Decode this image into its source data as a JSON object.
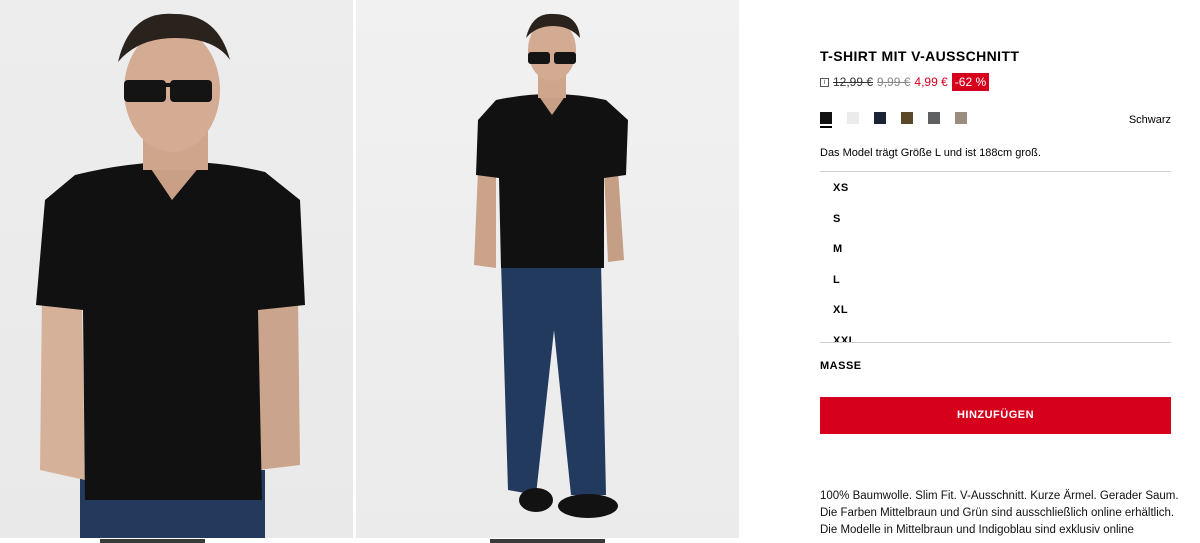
{
  "product": {
    "title": "T-SHIRT MIT V-AUSSCHNITT",
    "info_icon": "i",
    "price_original": "12,99 €",
    "price_previous": "9,99 €",
    "price_current": "4,99 €",
    "discount": "-62 %",
    "colors": [
      {
        "name": "black",
        "hex": "#111111",
        "selected": true
      },
      {
        "name": "white",
        "hex": "#ebebeb",
        "selected": false
      },
      {
        "name": "navy",
        "hex": "#1b2435",
        "selected": false
      },
      {
        "name": "olive",
        "hex": "#5a4a2a",
        "selected": false
      },
      {
        "name": "grey",
        "hex": "#5f6062",
        "selected": false
      },
      {
        "name": "taupe",
        "hex": "#9b8c80",
        "selected": false
      }
    ],
    "selected_color_label": "Schwarz",
    "model_note": "Das Model trägt Größe L und ist 188cm groß.",
    "sizes": [
      "XS",
      "S",
      "M",
      "L",
      "XL",
      "XXL"
    ],
    "measurements_label": "MASSE",
    "add_button": "HINZUFÜGEN",
    "description_lines": [
      "100% Baumwolle. Slim Fit. V-Ausschnitt. Kurze Ärmel. Gerader Saum.",
      "Die Farben Mittelbraun und Grün sind ausschließlich online erhältlich.",
      "Die Modelle in Mittelbraun und Indigoblau sind exklusiv online"
    ],
    "accent_color": "#d6001c"
  }
}
